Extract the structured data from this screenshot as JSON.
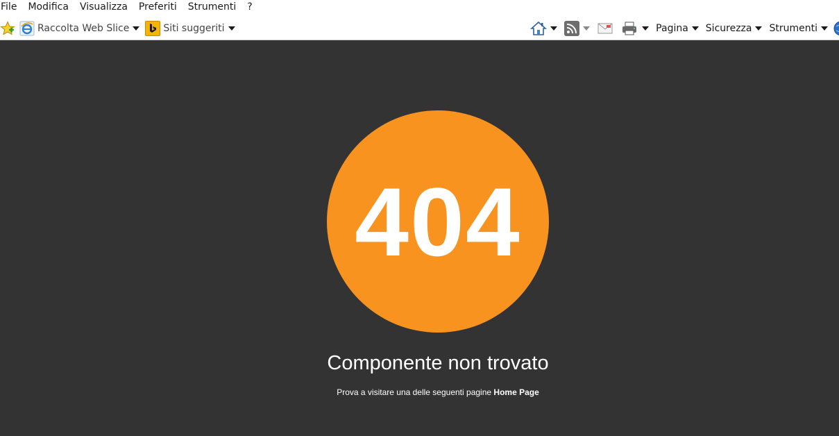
{
  "menubar": {
    "items": [
      "File",
      "Modifica",
      "Visualizza",
      "Preferiti",
      "Strumenti",
      "?"
    ]
  },
  "favorites": {
    "web_slice_label": "Raccolta Web Slice",
    "suggested_label": "Siti suggeriti"
  },
  "commandbar": {
    "page_label": "Pagina",
    "security_label": "Sicurezza",
    "tools_label": "Strumenti"
  },
  "icons": {
    "favorites": "star-icon",
    "web_slice": "ie-icon",
    "suggested": "bing-icon",
    "home": "home-icon",
    "feeds": "rss-icon",
    "mail": "mail-icon",
    "print": "print-icon",
    "help": "globe-icon"
  },
  "colors": {
    "page_background": "#333333",
    "accent": "#f7931e",
    "text": "#ffffff"
  },
  "error": {
    "code": "404",
    "title": "Componente non trovato",
    "hint_text": "Prova a visitare una delle seguenti pagine",
    "home_link": "Home Page"
  }
}
